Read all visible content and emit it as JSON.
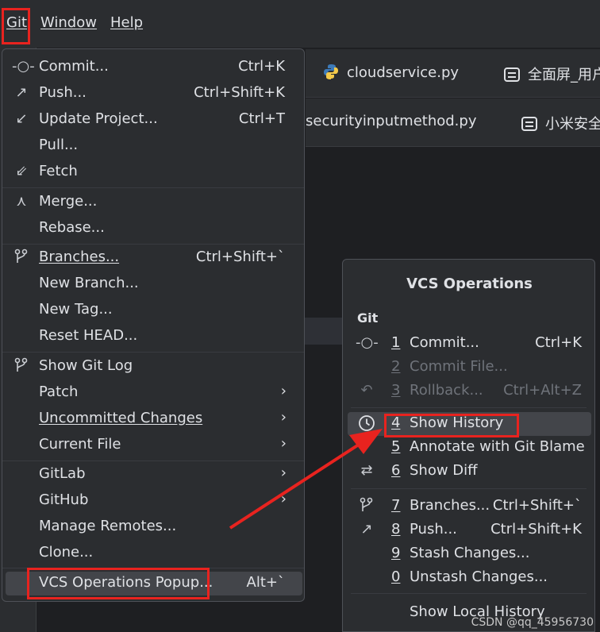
{
  "menubar": {
    "items": [
      {
        "label": "Git"
      },
      {
        "label": "Window"
      },
      {
        "label": "Help"
      }
    ]
  },
  "tabs": {
    "row1": [
      {
        "label": "cloudservice.py",
        "icon": "python-file-icon"
      },
      {
        "label": "全面屏_用户",
        "icon": "robot-icon"
      }
    ],
    "row2": [
      {
        "label": "securityinputmethod.py"
      },
      {
        "label": "小米安全",
        "icon": "robot-icon"
      }
    ]
  },
  "git_menu": {
    "items": [
      {
        "label": "Commit...",
        "shortcut": "Ctrl+K",
        "icon": "commit-icon"
      },
      {
        "label": "Push...",
        "shortcut": "Ctrl+Shift+K",
        "icon": "push-arrow-icon"
      },
      {
        "label": "Update Project...",
        "shortcut": "Ctrl+T",
        "icon": "update-arrow-icon"
      },
      {
        "label": "Pull..."
      },
      {
        "label": "Fetch",
        "icon": "fetch-icon"
      },
      {
        "label": "Merge...",
        "icon": "merge-icon"
      },
      {
        "label": "Rebase..."
      },
      {
        "label": "Branches...",
        "shortcut": "Ctrl+Shift+`",
        "icon": "branch-icon"
      },
      {
        "label": "New Branch..."
      },
      {
        "label": "New Tag..."
      },
      {
        "label": "Reset HEAD..."
      },
      {
        "label": "Show Git Log",
        "icon": "branch-icon"
      },
      {
        "label": "Patch"
      },
      {
        "label": "Uncommitted Changes"
      },
      {
        "label": "Current File"
      },
      {
        "label": "GitLab"
      },
      {
        "label": "GitHub"
      },
      {
        "label": "Manage Remotes..."
      },
      {
        "label": "Clone..."
      },
      {
        "label": "VCS Operations Popup...",
        "shortcut": "Alt+`"
      }
    ],
    "submenu_chevron": "›"
  },
  "vcs_popup": {
    "title": "VCS Operations",
    "section": "Git",
    "items": [
      {
        "num": "1",
        "label": "Commit...",
        "shortcut": "Ctrl+K",
        "icon": "commit-icon"
      },
      {
        "num": "2",
        "label": "Commit File..."
      },
      {
        "num": "3",
        "label": "Rollback...",
        "shortcut": "Ctrl+Alt+Z",
        "icon": "rollback-icon"
      },
      {
        "num": "4",
        "label": "Show History",
        "icon": "clock-icon"
      },
      {
        "num": "5",
        "label": "Annotate with Git Blame"
      },
      {
        "num": "6",
        "label": "Show Diff",
        "icon": "diff-arrows-icon"
      },
      {
        "num": "7",
        "label": "Branches...",
        "shortcut": "Ctrl+Shift+`",
        "icon": "branch-icon"
      },
      {
        "num": "8",
        "label": "Push...",
        "shortcut": "Ctrl+Shift+K",
        "icon": "push-arrow-icon"
      },
      {
        "num": "9",
        "label": "Stash Changes..."
      },
      {
        "num": "0",
        "label": "Unstash Changes..."
      },
      {
        "label": "Show Local History"
      }
    ]
  },
  "watermark": "CSDN @qq_45956730",
  "colors": {
    "annotation_red": "#e8231f",
    "selection": "#43454a",
    "background": "#2b2d30"
  }
}
